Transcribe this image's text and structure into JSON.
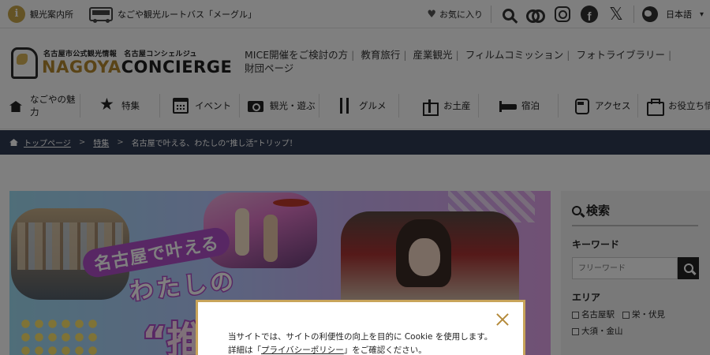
{
  "topbar": {
    "tourist_info": "観光案内所",
    "bus_route": "なごや観光ルートバス「メーグル」",
    "favorites": "お気に入り",
    "language": "日本語",
    "icons": [
      "info-icon",
      "bus-icon",
      "heart-icon",
      "search-icon",
      "tripadvisor-icon",
      "instagram-icon",
      "facebook-icon",
      "x-icon",
      "globe-icon",
      "chevron-down-icon"
    ]
  },
  "header": {
    "logo_sub": "名古屋市公式観光情報　名古屋コンシェルジュ",
    "logo_nagoya": "NAGOYA",
    "logo_concierge": "CONCIERGE",
    "links": [
      "MICE開催をご検討の方",
      "教育旅行",
      "産業観光",
      "フィルムコミッション",
      "フォトライブラリー",
      "財団ページ"
    ]
  },
  "nav": {
    "items": [
      {
        "label": "なごやの魅力",
        "icon": "castle-icon"
      },
      {
        "label": "特集",
        "icon": "star-icon"
      },
      {
        "label": "イベント",
        "icon": "calendar-icon"
      },
      {
        "label": "観光・遊ぶ",
        "icon": "camera-icon"
      },
      {
        "label": "グルメ",
        "icon": "fork-knife-icon"
      },
      {
        "label": "お土産",
        "icon": "gift-icon"
      },
      {
        "label": "宿泊",
        "icon": "bed-icon"
      },
      {
        "label": "アクセス",
        "icon": "train-icon"
      },
      {
        "label": "お役立ち情報",
        "icon": "bag-icon"
      }
    ]
  },
  "breadcrumb": {
    "home": "トップページ",
    "feature": "特集",
    "current": "名古屋で叶える、わたしの“推し活”トリップ！"
  },
  "hero": {
    "line1": "名古屋で叶える",
    "line2": "わたしの",
    "line3": "“推"
  },
  "sidebar": {
    "title": "検索",
    "keyword_label": "キーワード",
    "keyword_placeholder": "フリーワード",
    "area_label": "エリア",
    "areas": [
      "名古屋駅",
      "栄・伏見",
      "大須・金山"
    ]
  },
  "cookie_modal": {
    "line1": "当サイトでは、サイトの利便性の向上を目的に Cookie を使用します。",
    "line2_prefix": "詳細は「",
    "privacy_link": "プライバシーポリシー",
    "line2_suffix": "」をご確認ください。"
  },
  "colors": {
    "accent_gold": "#c8a64a",
    "breadcrumb_bg": "#2f3b52",
    "modal_border": "#c8a45a"
  }
}
